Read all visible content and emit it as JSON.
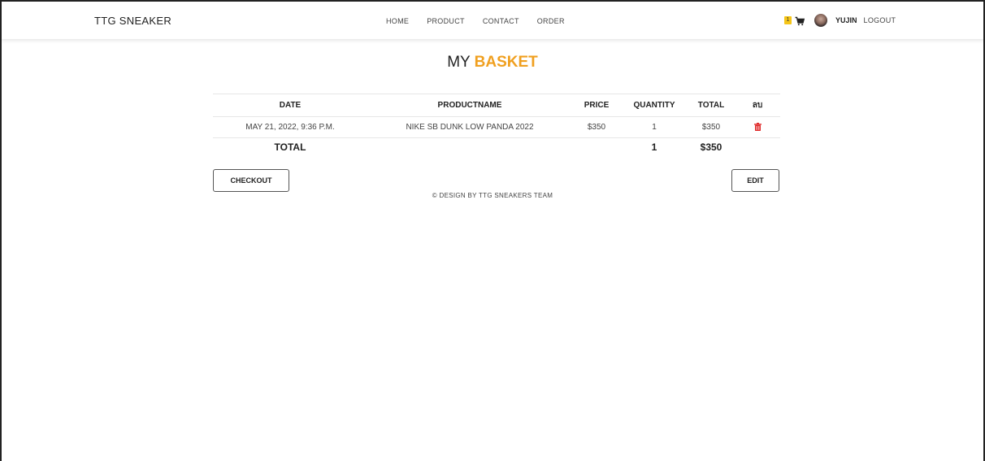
{
  "navbar": {
    "brand": "TTG SNEAKER",
    "links": [
      "HOME",
      "PRODUCT",
      "CONTACT",
      "ORDER"
    ],
    "cart_count": "1",
    "username": "YUJIN",
    "logout_label": "LOGOUT",
    "icons": {
      "cart": "cart-icon",
      "avatar": "user-avatar"
    }
  },
  "page": {
    "title_plain": "MY",
    "title_accent": "BASKET",
    "accent_color": "#f0a020"
  },
  "table": {
    "headers": {
      "date": "DATE",
      "product": "PRODUCTNAME",
      "price": "PRICE",
      "quantity": "QUANTITY",
      "total": "TOTAL",
      "delete": "ลบ"
    },
    "rows": [
      {
        "date": "MAY 21, 2022, 9:36 P.M.",
        "product": "NIKE SB DUNK LOW PANDA 2022",
        "price": "$350",
        "quantity": "1",
        "total": "$350",
        "delete_icon": "trash-icon"
      }
    ],
    "summary": {
      "label": "TOTAL",
      "quantity": "1",
      "total": "$350"
    }
  },
  "actions": {
    "checkout_label": "CHECKOUT",
    "edit_label": "EDIT"
  },
  "footer": {
    "text": "© DESIGN BY TTG SNEAKERS TEAM"
  }
}
